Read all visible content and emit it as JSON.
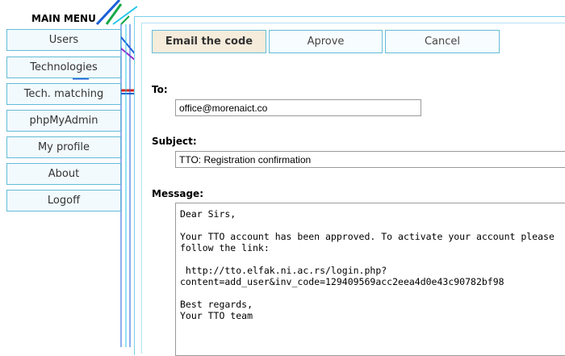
{
  "menu": {
    "title": "MAIN MENU",
    "items": [
      {
        "label": "Users"
      },
      {
        "label": "Technologies"
      },
      {
        "label": "Tech. matching"
      },
      {
        "label": "phpMyAdmin"
      },
      {
        "label": "My profile"
      },
      {
        "label": "About"
      },
      {
        "label": "Logoff"
      }
    ]
  },
  "actions": {
    "email_label": "Email the code",
    "approve_label": "Aprove",
    "cancel_label": "Cancel"
  },
  "form": {
    "to_label": "To:",
    "to_value": "office@morenaict.co",
    "subject_label": "Subject:",
    "subject_value": "TTO: Registration confirmation",
    "message_label": "Message:",
    "message_value": "Dear Sirs,\n\nYour TTO account has been approved. To activate your account please\nfollow the link:\n\n http://tto.elfak.ni.ac.rs/login.php?\ncontent=add_user&inv_code=129409569acc2eea4d0e43c90782bf98\n\nBest regards,\nYour TTO team"
  },
  "colors": {
    "accent_border": "#63bcd8",
    "primary_button_bg": "#f5ecdc"
  }
}
